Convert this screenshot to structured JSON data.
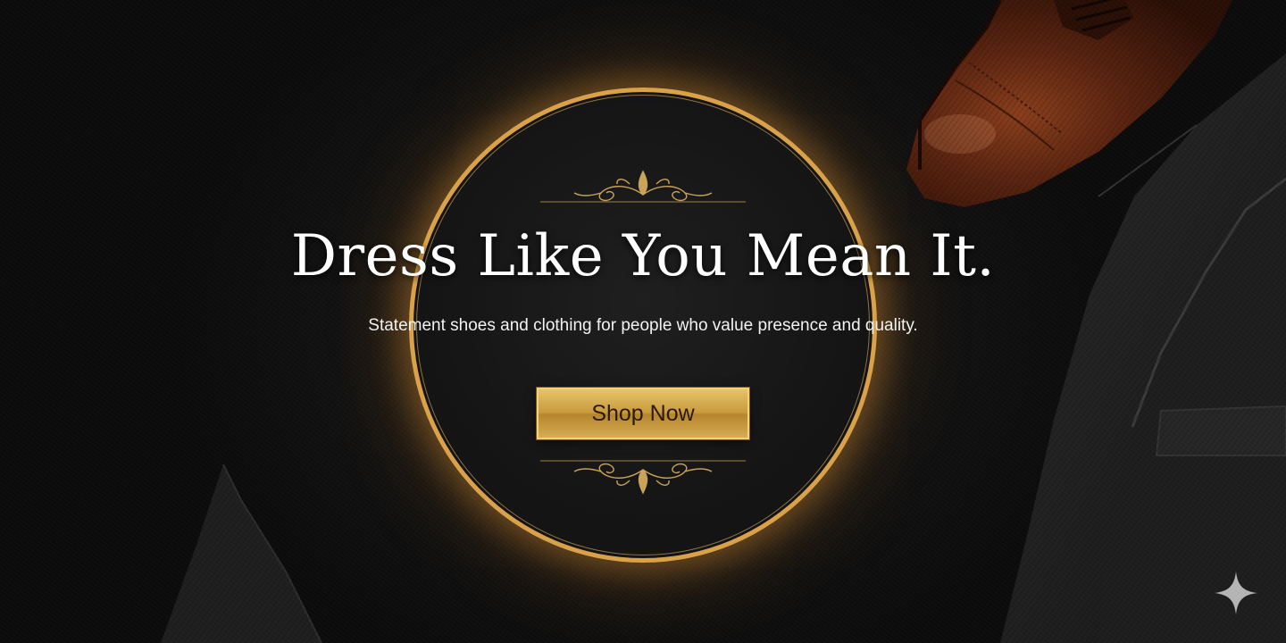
{
  "hero": {
    "headline": "Dress Like You Mean It.",
    "subheadline": "Statement shoes and clothing for people who value presence and quality.",
    "cta_label": "Shop Now"
  },
  "colors": {
    "background": "#111111",
    "gold_ring": "#d9a24a",
    "gold_button": "#c99b3c",
    "headline_text": "#ffffff",
    "button_text": "#2a1a06"
  },
  "icons": {
    "top_ornament": "gold-flourish-icon",
    "bottom_ornament": "gold-flourish-icon",
    "corner_mark": "four-point-sparkle-icon"
  }
}
